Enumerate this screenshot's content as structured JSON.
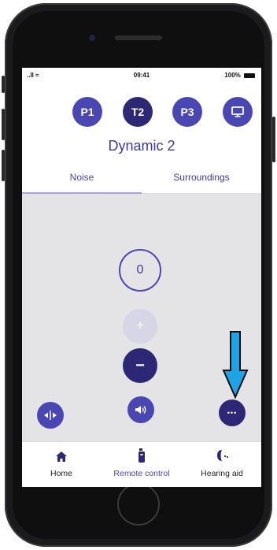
{
  "status_bar": {
    "signal": "..ll",
    "time": "09:41",
    "battery": "100%"
  },
  "programs": [
    {
      "label": "P1",
      "color": "#4b47b2"
    },
    {
      "label": "T2",
      "color": "#2c2875"
    },
    {
      "label": "P3",
      "color": "#4b47b2"
    }
  ],
  "stream_button": {
    "icon": "monitor-icon",
    "color": "#4b47b2"
  },
  "program_title": "Dynamic 2",
  "tabs": [
    {
      "label": "Noise",
      "active": true
    },
    {
      "label": "Surroundings",
      "active": false
    }
  ],
  "volume": {
    "value": "0"
  },
  "controls": {
    "plus_label": "+",
    "minus_label": "−",
    "more_label": "•••"
  },
  "nav": [
    {
      "label": "Home",
      "icon": "home-icon"
    },
    {
      "label": "Remote control",
      "icon": "remote-icon",
      "active": true
    },
    {
      "label": "Hearing aid",
      "icon": "hearing-aid-icon"
    }
  ],
  "colors": {
    "accent": "#4b47b2",
    "dark_accent": "#2c2875",
    "disabled": "#d7d6e7",
    "arrow": "#1ea4e6",
    "background": "#e4e4e7"
  }
}
